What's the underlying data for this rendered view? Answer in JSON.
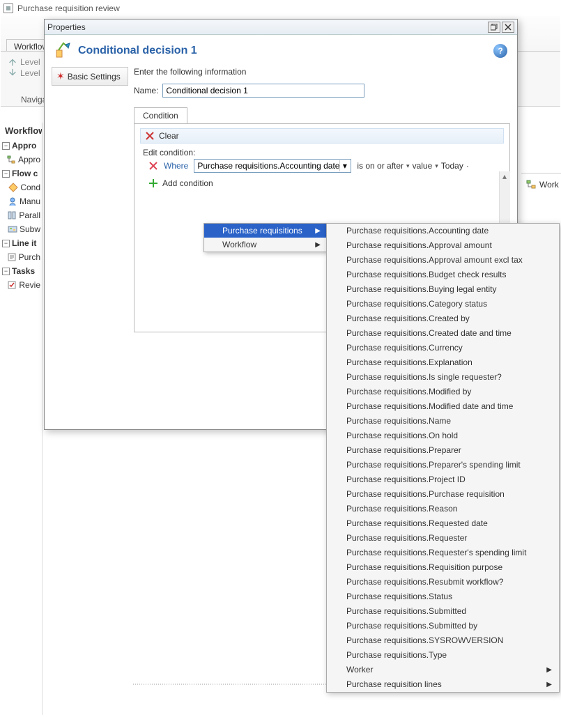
{
  "app": {
    "title": "Purchase requisition review"
  },
  "ribbon": {
    "tab": "Workflow",
    "level_up": "Level",
    "level_down": "Level",
    "naviga": "Naviga"
  },
  "left": {
    "header": "Workflow",
    "items": [
      {
        "toggle": "-",
        "icon": "doc",
        "text": "Appro"
      },
      {
        "toggle": "",
        "icon": "flow",
        "text": "Appro"
      },
      {
        "toggle": "-",
        "icon": "doc",
        "text": "Flow c"
      },
      {
        "toggle": "",
        "icon": "cond",
        "text": "Cond"
      },
      {
        "toggle": "",
        "icon": "manu",
        "text": "Manu"
      },
      {
        "toggle": "",
        "icon": "para",
        "text": "Parall"
      },
      {
        "toggle": "",
        "icon": "subw",
        "text": "Subw"
      },
      {
        "toggle": "-",
        "icon": "doc",
        "text": "Line it"
      },
      {
        "toggle": "",
        "icon": "purc",
        "text": "Purch"
      },
      {
        "toggle": "-",
        "icon": "doc",
        "text": "Tasks"
      },
      {
        "toggle": "",
        "icon": "rev",
        "text": "Revie"
      }
    ]
  },
  "dialog": {
    "title": "Properties",
    "heading": "Conditional decision 1",
    "side_tab": "Basic Settings",
    "instruction": "Enter the following information",
    "name_label": "Name:",
    "name_value": "Conditional decision 1",
    "tab_label": "Condition",
    "clear": "Clear",
    "edit_condition": "Edit condition:",
    "where": "Where",
    "combo_value": "Purchase requisitions.Accounting date",
    "tail1": "is on or after",
    "tail2": "value",
    "tail3": "Today",
    "add_condition": "Add condition"
  },
  "submenu1": [
    {
      "label": "Purchase requisitions",
      "selected": true,
      "arrow": true
    },
    {
      "label": "Workflow",
      "selected": false,
      "arrow": true
    }
  ],
  "submenu2": [
    {
      "label": "Purchase requisitions.Accounting date"
    },
    {
      "label": "Purchase requisitions.Approval amount"
    },
    {
      "label": "Purchase requisitions.Approval amount excl tax"
    },
    {
      "label": "Purchase requisitions.Budget check results"
    },
    {
      "label": "Purchase requisitions.Buying legal entity"
    },
    {
      "label": "Purchase requisitions.Category status"
    },
    {
      "label": "Purchase requisitions.Created by"
    },
    {
      "label": "Purchase requisitions.Created date and time"
    },
    {
      "label": "Purchase requisitions.Currency"
    },
    {
      "label": "Purchase requisitions.Explanation"
    },
    {
      "label": "Purchase requisitions.Is single requester?"
    },
    {
      "label": "Purchase requisitions.Modified by"
    },
    {
      "label": "Purchase requisitions.Modified date and time"
    },
    {
      "label": "Purchase requisitions.Name"
    },
    {
      "label": "Purchase requisitions.On hold"
    },
    {
      "label": "Purchase requisitions.Preparer"
    },
    {
      "label": "Purchase requisitions.Preparer's spending limit"
    },
    {
      "label": "Purchase requisitions.Project ID"
    },
    {
      "label": "Purchase requisitions.Purchase requisition"
    },
    {
      "label": "Purchase requisitions.Reason"
    },
    {
      "label": "Purchase requisitions.Requested date"
    },
    {
      "label": "Purchase requisitions.Requester"
    },
    {
      "label": "Purchase requisitions.Requester's spending limit"
    },
    {
      "label": "Purchase requisitions.Requisition purpose"
    },
    {
      "label": "Purchase requisitions.Resubmit workflow?"
    },
    {
      "label": "Purchase requisitions.Status"
    },
    {
      "label": "Purchase requisitions.Submitted"
    },
    {
      "label": "Purchase requisitions.Submitted by"
    },
    {
      "label": "Purchase requisitions.SYSROWVERSION"
    },
    {
      "label": "Purchase requisitions.Type"
    },
    {
      "label": "Worker",
      "arrow": true
    },
    {
      "label": "Purchase requisition lines",
      "arrow": true
    }
  ],
  "right_peek": {
    "item": "Work"
  }
}
